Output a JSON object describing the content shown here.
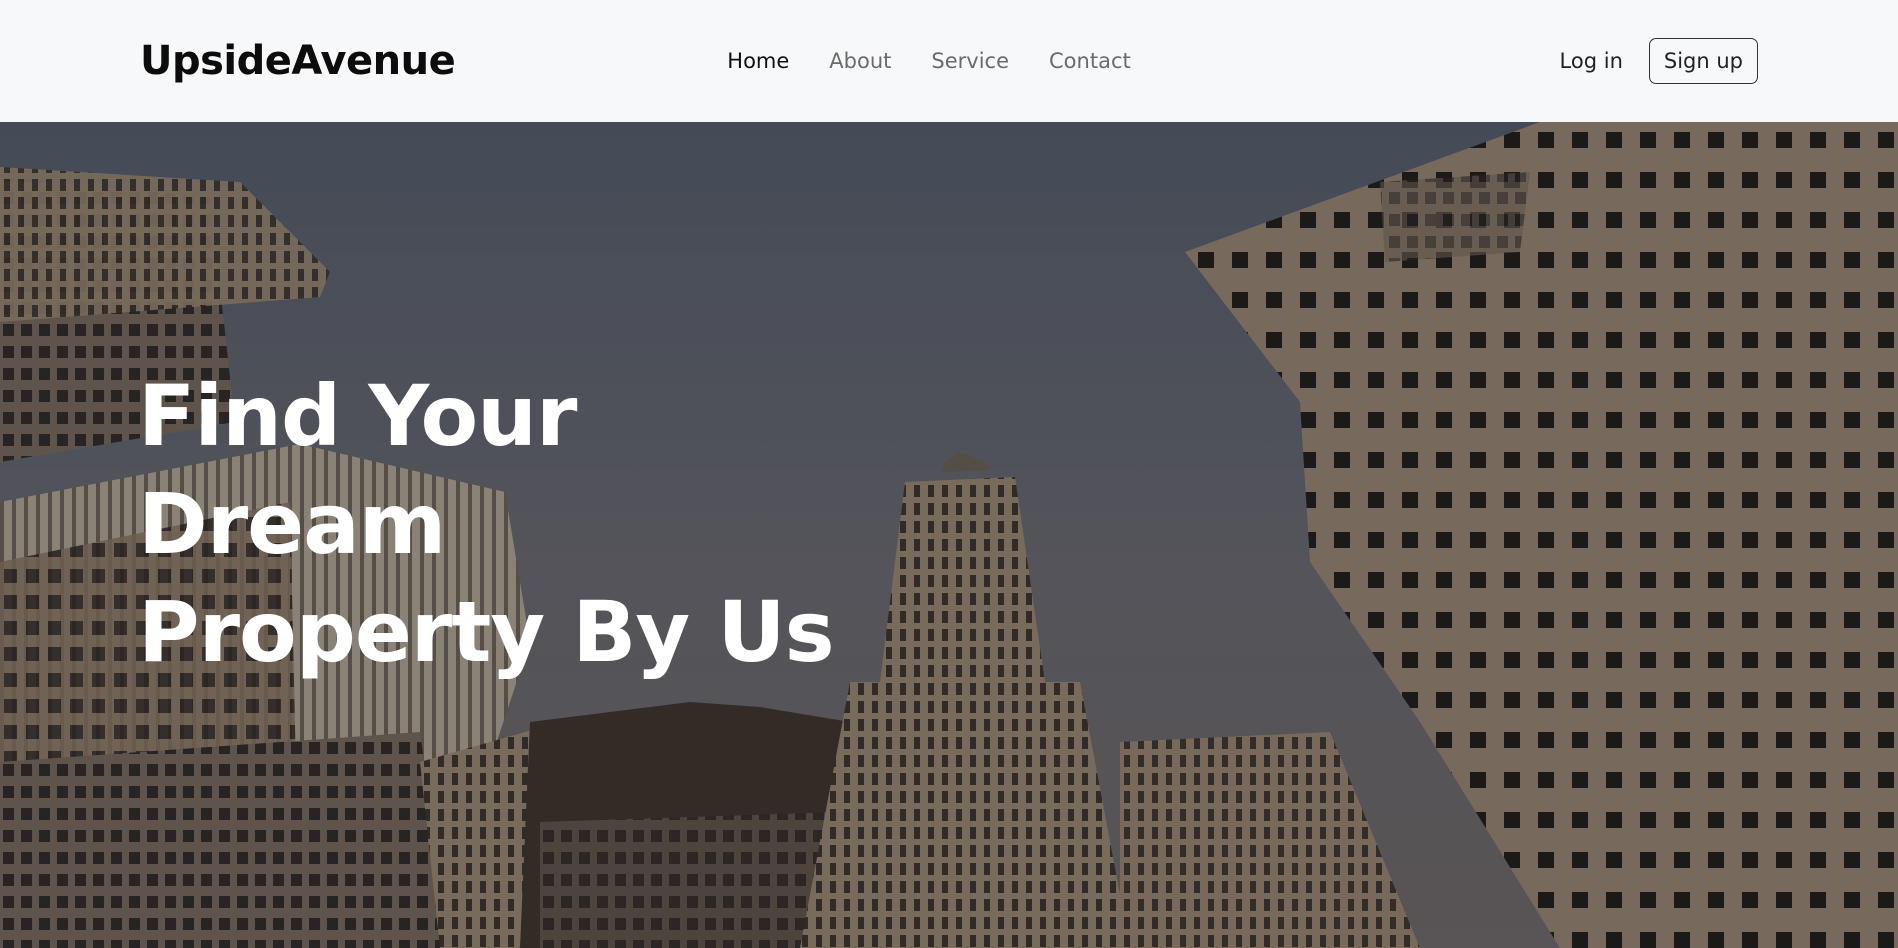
{
  "brand": {
    "name": "UpsideAvenue"
  },
  "nav": {
    "links": [
      {
        "label": "Home",
        "active": true
      },
      {
        "label": "About",
        "active": false
      },
      {
        "label": "Service",
        "active": false
      },
      {
        "label": "Contact",
        "active": false
      }
    ]
  },
  "auth": {
    "login_label": "Log in",
    "signup_label": "Sign up"
  },
  "hero": {
    "title_line1": "Find Your Dream",
    "title_line2": "Property By Us",
    "background": "upward view of city skyscrapers against a cloudy sky"
  },
  "colors": {
    "nav_bg": "#f7f8fa",
    "text_dark": "#0c0c0c",
    "nav_inactive": "#6b6b6b",
    "hero_text": "#ffffff"
  }
}
